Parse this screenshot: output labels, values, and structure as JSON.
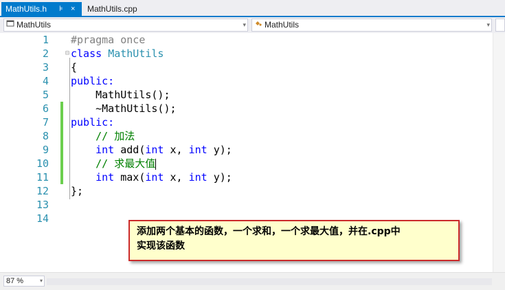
{
  "tabs": {
    "active_label": "MathUtils.h",
    "pin_glyph": "⊧",
    "close_glyph": "×",
    "inactive_label": "MathUtils.cpp"
  },
  "navbar": {
    "left_combo": "MathUtils",
    "right_combo": "MathUtils",
    "dropdown_glyph": "▾"
  },
  "editor": {
    "line_numbers": [
      "1",
      "2",
      "3",
      "4",
      "5",
      "6",
      "7",
      "8",
      "9",
      "10",
      "11",
      "12",
      "13",
      "14"
    ],
    "collapse_glyph": "⊟",
    "code": {
      "l1": "#pragma once",
      "l2_kw": "class",
      "l2_name": "MathUtils",
      "l3": "{",
      "l4": "public:",
      "l5": "    MathUtils();",
      "l6": "    ~MathUtils();",
      "l7": "public:",
      "l8": "    // 加法",
      "l9_kw1": "int",
      "l9_fn": " add(",
      "l9_kw2": "int",
      "l9_x": " x, ",
      "l9_kw3": "int",
      "l9_end": " y);",
      "l10": "    // 求最大值",
      "l11_kw1": "int",
      "l11_fn": " max(",
      "l11_kw2": "int",
      "l11_x": " x, ",
      "l11_kw3": "int",
      "l11_end": " y);",
      "l12": "};"
    }
  },
  "annotation": {
    "line1": "添加两个基本的函数，一个求和，一个求最大值，并在.cpp中",
    "line2": "实现该函数"
  },
  "statusbar": {
    "zoom": "87 %"
  },
  "colors": {
    "accent": "#007acc",
    "keyword": "#0000ff",
    "type": "#2b91af",
    "comment": "#008000",
    "preprocessor": "#808080",
    "change_bar": "#6bcf4e",
    "note_border": "#cc2a2a",
    "note_bg": "#ffffcc"
  }
}
